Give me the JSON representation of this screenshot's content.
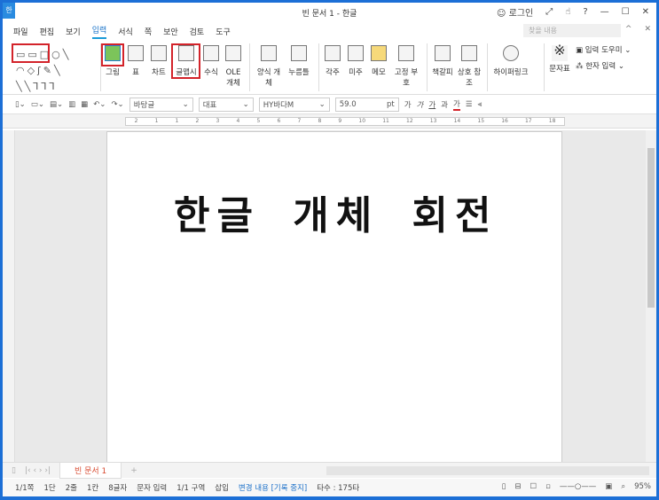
{
  "window": {
    "title": "빈 문서 1 - 한글",
    "app_icon": "한",
    "login": "로그인"
  },
  "menu": {
    "items": [
      "파일",
      "편집",
      "보기",
      "입력",
      "서식",
      "쪽",
      "보안",
      "검토",
      "도구"
    ],
    "active": "입력",
    "search_placeholder": "찾을 내용"
  },
  "ribbon": {
    "items": [
      "그림",
      "표",
      "차트",
      "글맵시",
      "수식",
      "OLE 개체",
      "양식 개체",
      "누름틀",
      "각주",
      "미주",
      "메모",
      "고정 부호",
      "책갈피",
      "상호 참조",
      "하이퍼링크",
      "문자표"
    ],
    "side": [
      "입력 도우미",
      "한자 입력"
    ]
  },
  "toolbar": {
    "style": "바탕글",
    "style2": "대표",
    "font": "HY바다M",
    "size": "59.0",
    "unit": "pt",
    "glyphs": [
      "가",
      "가",
      "가",
      "과",
      "가"
    ]
  },
  "ruler": {
    "ticks": [
      "2",
      "1",
      "1",
      "2",
      "3",
      "4",
      "5",
      "6",
      "7",
      "8",
      "9",
      "10",
      "11",
      "12",
      "13",
      "14",
      "15",
      "16",
      "17",
      "18"
    ]
  },
  "document": {
    "text": "한글 개체 회전"
  },
  "tabs": {
    "active": "빈 문서 1",
    "add": "+"
  },
  "status": {
    "items": [
      "1/1쪽",
      "1단",
      "2줄",
      "1칸",
      "8글자",
      "문자 입력",
      "1/1 구역",
      "삽입"
    ],
    "track": "변경 내용 [기록 중지]",
    "typing": "타수 : 175타",
    "zoom": "95%"
  },
  "colors": {
    "frame": "#1c6fd6",
    "highlight": "#d3232a",
    "accent": "#1a73c8"
  }
}
